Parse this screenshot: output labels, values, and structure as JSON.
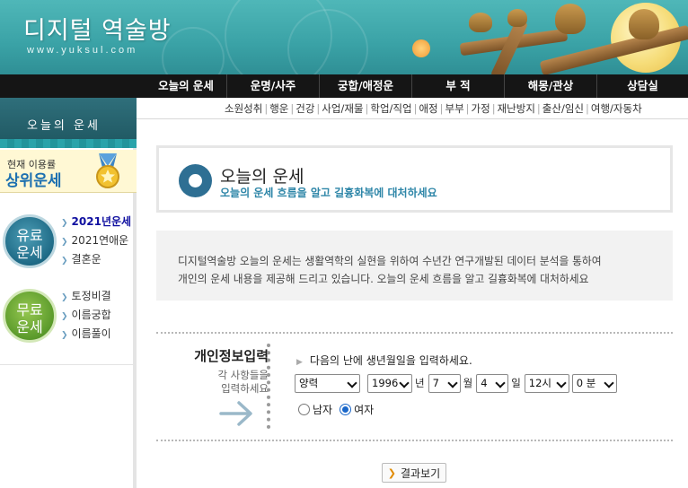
{
  "site": {
    "logo_title": "디지털 역술방",
    "logo_url": "www.yuksul.com"
  },
  "topnav": [
    "오늘의 운세",
    "운명/사주",
    "궁합/애정운",
    "부 적",
    "해몽/관상",
    "상담실"
  ],
  "subnav": [
    "소원성취",
    "행운",
    "건강",
    "사업/재물",
    "학업/직업",
    "애정",
    "부부",
    "가정",
    "재난방지",
    "출산/임신",
    "여행/자동차"
  ],
  "sidebar": {
    "header": "오늘의 운세",
    "rank_line1": "현재 이용률",
    "rank_line2": "상위운세",
    "paid_badge": [
      "유료",
      "운세"
    ],
    "paid_items": [
      "2021년운세",
      "2021연애운",
      "결혼운"
    ],
    "free_badge": [
      "무료",
      "운세"
    ],
    "free_items": [
      "토정비결",
      "이름궁합",
      "이름풀이"
    ]
  },
  "main": {
    "title": "오늘의 운세",
    "subtitle": "오늘의 운세 흐름을 알고 길흉화복에 대처하세요",
    "description": [
      "디지털역술방 오늘의 운세는 생활역학의 실현을 위하여 수년간 연구개발된 데이터 분석을 통하여",
      "개인의 운세 내용을 제공해 드리고 있습니다. 오늘의 운세 흐름을 알고 길흉화복에 대처하세요"
    ]
  },
  "form": {
    "heading": "개인정보입력",
    "sub1": "각 사항들을",
    "sub2": "입력하세요",
    "prompt": "다음의 난에 생년월일을 입력하세요.",
    "calendar": "양력",
    "year": "1996",
    "year_unit": "년",
    "month": "7",
    "month_unit": "월",
    "day": "4",
    "day_unit": "일",
    "hour": "12시",
    "minute": "0 분",
    "gender_male": "남자",
    "gender_female": "여자",
    "gender_selected": "여자",
    "submit": "결과보기"
  },
  "colors": {
    "banner": "#3aa2a6",
    "nav_bg": "#151515",
    "accent_blue": "#2e86a8",
    "active_link": "#1010a0"
  }
}
